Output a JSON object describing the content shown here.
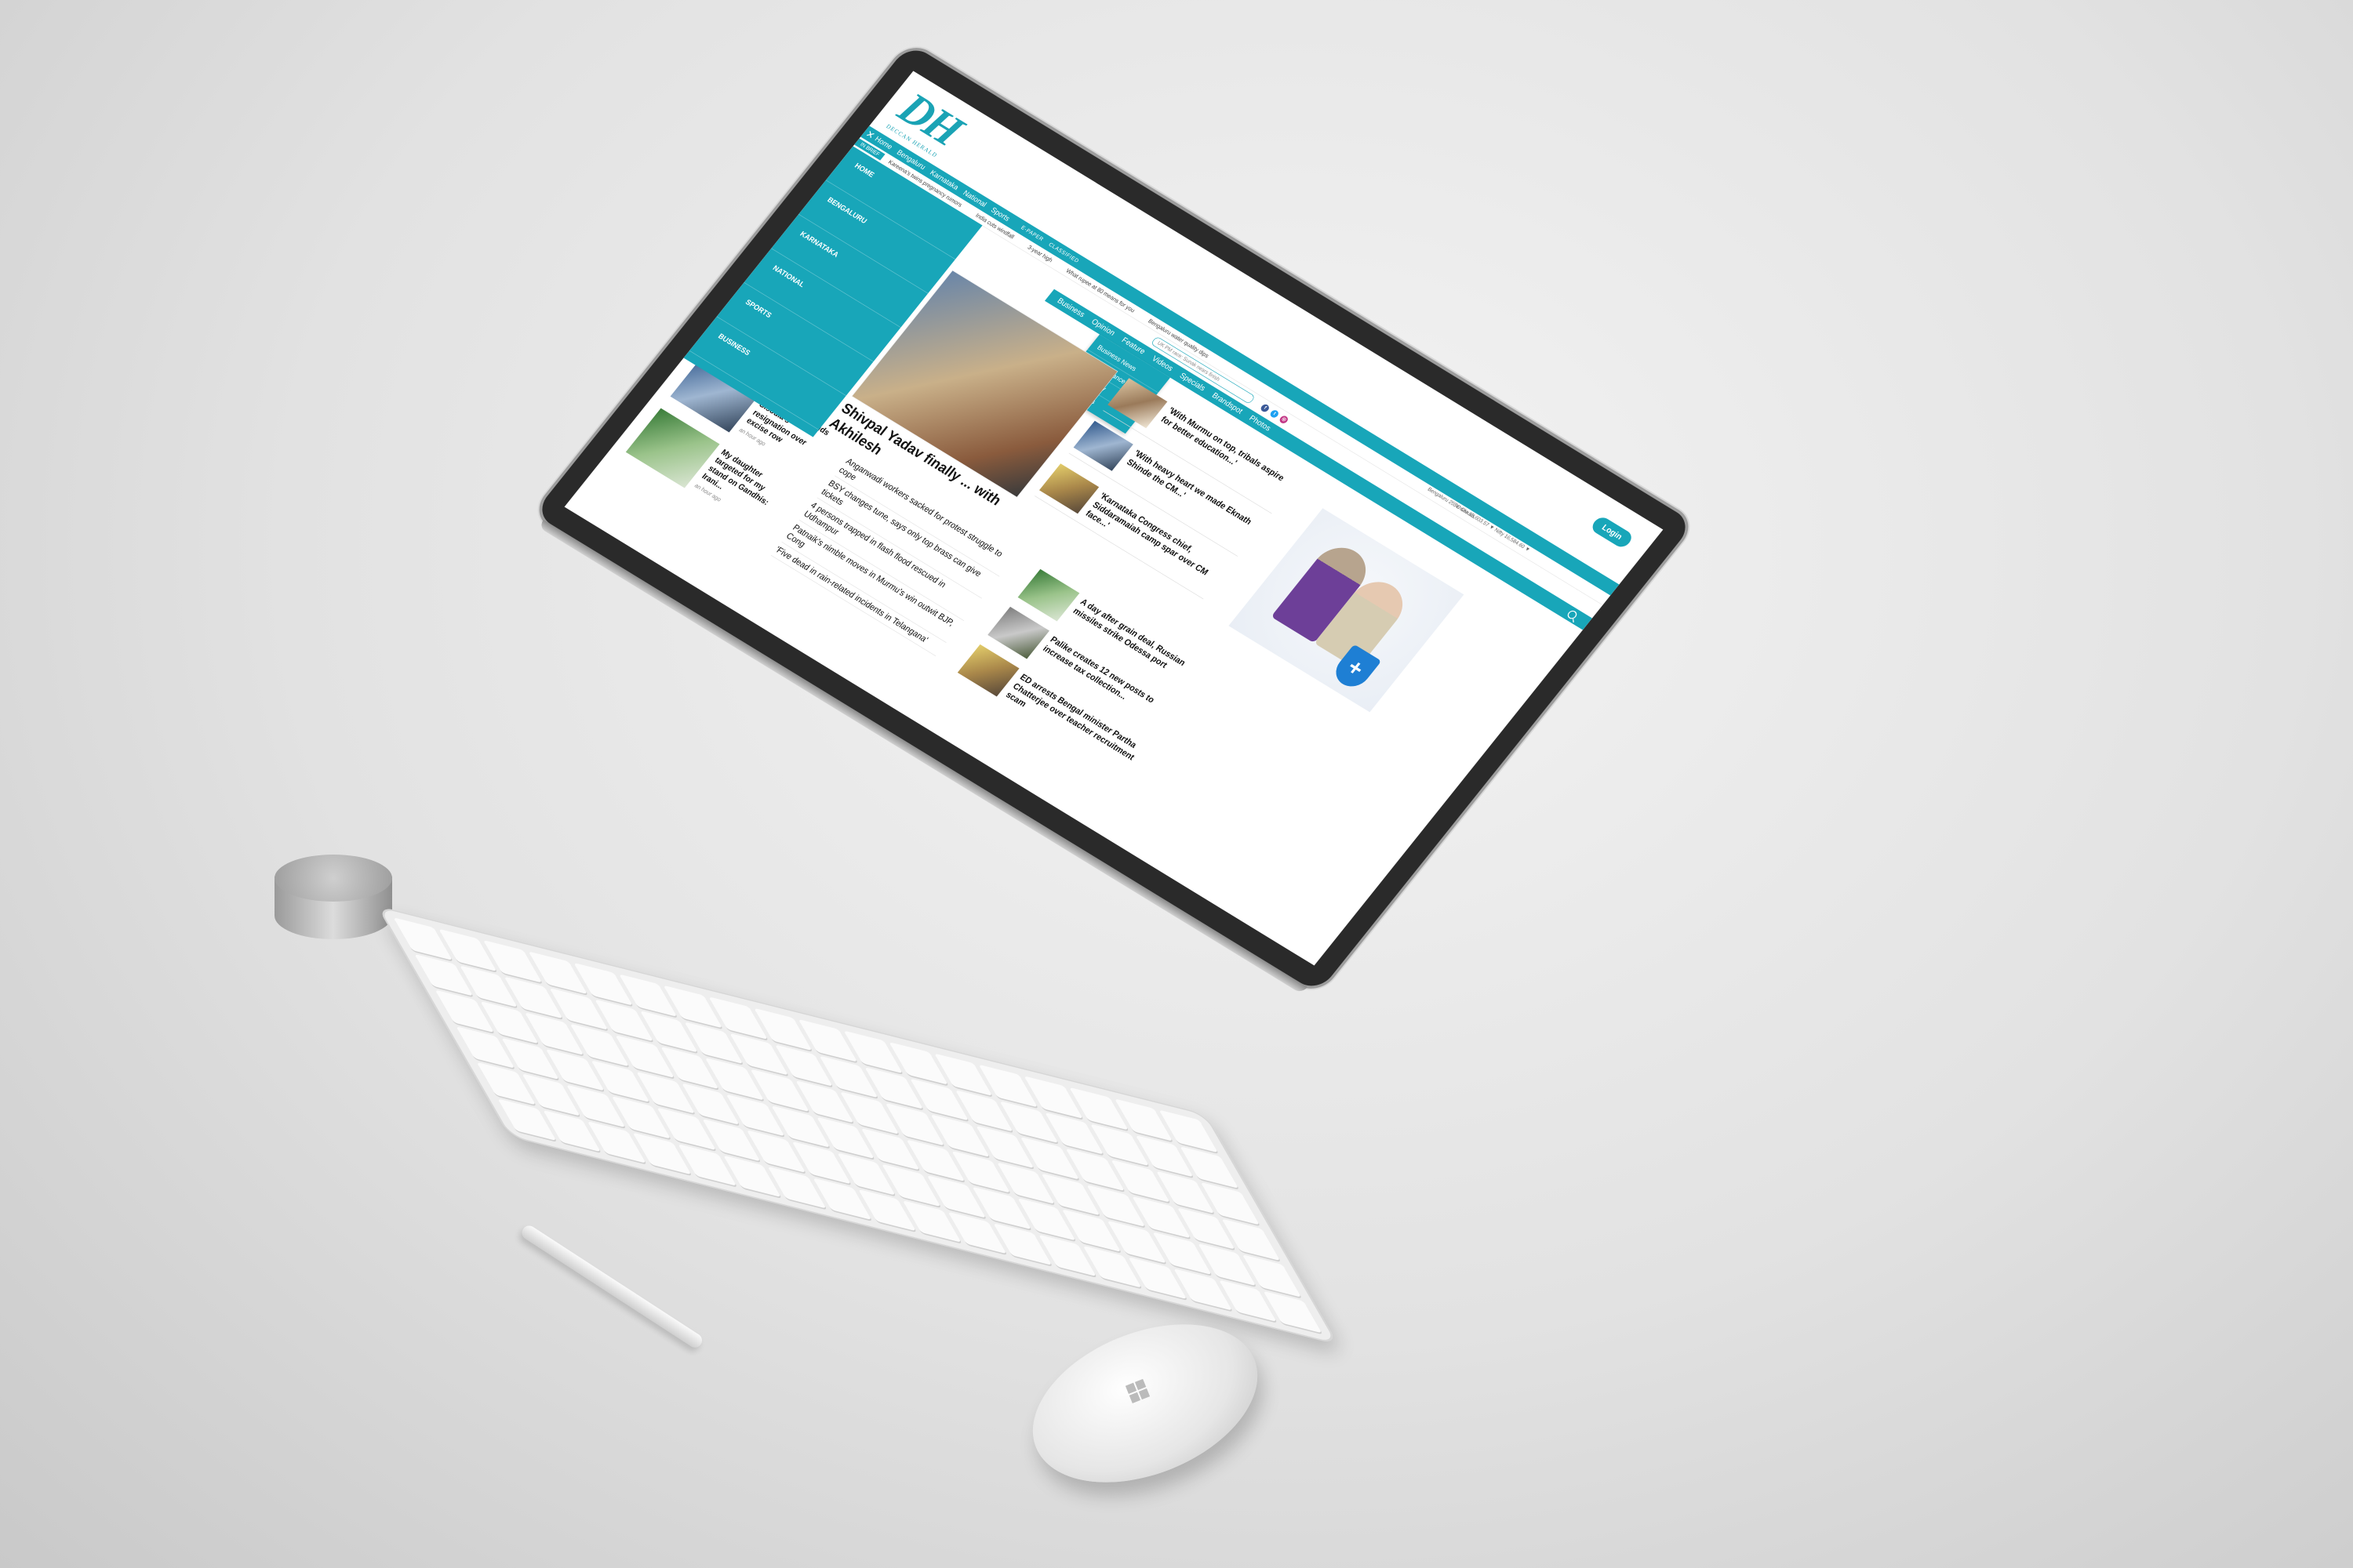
{
  "site": {
    "logo_text": "DH",
    "logo_sub": "DECCAN HERALD",
    "login_label": "Login"
  },
  "topbar": {
    "close_icon": "close-icon",
    "nav": [
      "Home",
      "Bengaluru",
      "Karnataka",
      "National",
      "Sports",
      "Business",
      "Opinion",
      "Feature",
      "Videos",
      "Specials",
      "Brandspot",
      "Photos"
    ],
    "misc": [
      "E-PAPER",
      "CLASSIFIED"
    ]
  },
  "brief": {
    "tag": "IN BRIEF",
    "items": [
      "Kareena's twins pregnancy rumors",
      "India cuts windfall",
      "3-year high",
      "What rupee at 80 means for you",
      "Bengaluru water quality dips"
    ]
  },
  "weather": "Bengaluru 25 °C Clouds",
  "markets": [
    "Sensex 55,603.57 ▼",
    "Nifty 16,584.60 ▼"
  ],
  "search": {
    "placeholder": "UK PM race: Sunak nears finish"
  },
  "sidebar": {
    "items": [
      "HOME",
      "BENGALURU",
      "KARNATAKA",
      "NATIONAL",
      "SPORTS",
      "BUSINESS"
    ]
  },
  "dropdown": {
    "items": [
      "Business News",
      "Family Finance",
      "Technology",
      "DH Wheels"
    ]
  },
  "lead": {
    "title": "Shivpal Yadav finally ... with Akhilesh"
  },
  "side_stories": [
    "'With Murmu on top, tribals aspire for better education...'",
    "'With heavy heart we made Eknath Shinde the CM...'",
    "'Karnataka Congress chief, Siddaramaiah camp spar over CM face...'"
  ],
  "left_stories": [
    {
      "title": "Congress demands Sisodia's resignation over excise row",
      "time": "an hour ago"
    },
    {
      "title": "My daughter targeted for my stand on Gandhis: Irani...",
      "time": "an hour ago"
    }
  ],
  "mid_list": [
    "Anganwadi workers sacked for protest struggle to cope",
    "BSY changes tune, says only top brass can give tickets",
    "4 persons trapped in flash flood rescued in Udhampur",
    "Patnaik's nimble moves in Murmu's win outwit BJP, Cong",
    "'Five dead in rain-related incidents in Telangana'"
  ],
  "right_stories": [
    "A day after grain deal, Russian missiles strike Odessa port",
    "Palike creates 12 new posts to increase tax collection...",
    "ED arrests Bengal minister Partha Chatterjee over teacher recruitment scam"
  ],
  "colors": {
    "accent": "#18a6b9",
    "text": "#111111"
  }
}
